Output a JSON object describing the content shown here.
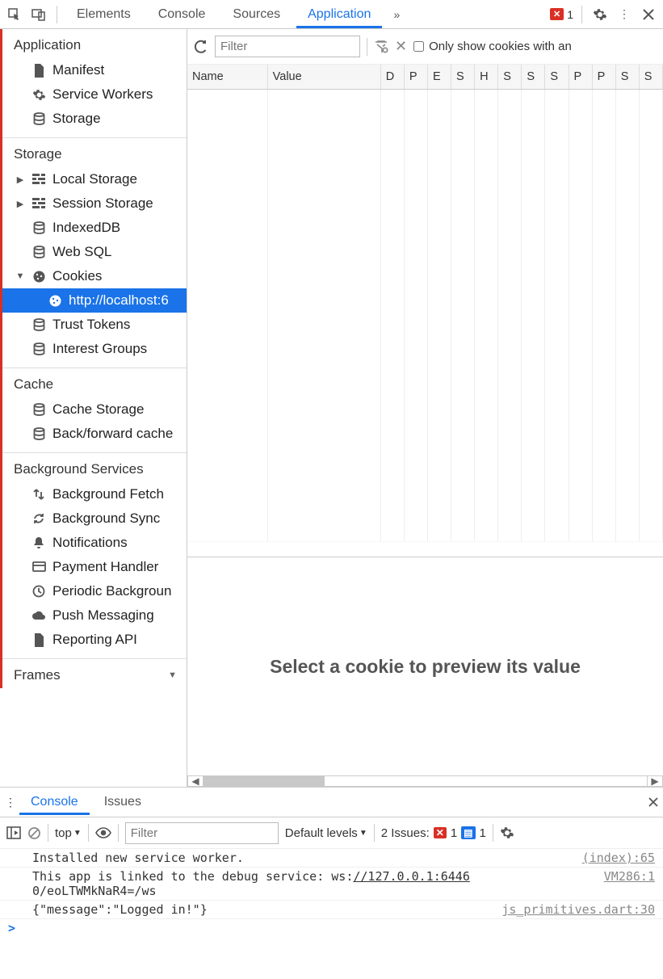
{
  "tabs": {
    "elements": "Elements",
    "console": "Console",
    "sources": "Sources",
    "application": "Application"
  },
  "error_count": "1",
  "sidebar": {
    "application": {
      "title": "Application",
      "manifest": "Manifest",
      "service_workers": "Service Workers",
      "storage": "Storage"
    },
    "storage": {
      "title": "Storage",
      "local": "Local Storage",
      "session": "Session Storage",
      "indexeddb": "IndexedDB",
      "websql": "Web SQL",
      "cookies": "Cookies",
      "cookie_origin": "http://localhost:6",
      "trust": "Trust Tokens",
      "interest": "Interest Groups"
    },
    "cache": {
      "title": "Cache",
      "cache_storage": "Cache Storage",
      "bf": "Back/forward cache"
    },
    "bg": {
      "title": "Background Services",
      "fetch": "Background Fetch",
      "sync": "Background Sync",
      "notif": "Notifications",
      "payment": "Payment Handler",
      "periodic": "Periodic Backgroun",
      "push": "Push Messaging",
      "reporting": "Reporting API"
    },
    "frames": {
      "title": "Frames"
    }
  },
  "cookie_toolbar": {
    "filter_placeholder": "Filter",
    "only_show": "Only show cookies with an"
  },
  "cookie_columns": [
    "Name",
    "Value",
    "D",
    "P",
    "E",
    "S",
    "H",
    "S",
    "S",
    "S",
    "P",
    "P",
    "S",
    "S"
  ],
  "preview_text": "Select a cookie to preview its value",
  "drawer": {
    "tabs": {
      "console": "Console",
      "issues": "Issues"
    },
    "toolbar": {
      "context": "top",
      "filter_placeholder": "Filter",
      "levels": "Default levels",
      "issues_label": "2 Issues:",
      "issue_err": "1",
      "issue_info": "1"
    },
    "lines": [
      {
        "msg": "Installed new service worker.",
        "src": "(index):65"
      },
      {
        "msg_pre": "This app is linked to the debug service: ws:",
        "msg_link": "//127.0.0.1:6446",
        "msg_post": "0/eoLTWMkNaR4=/ws",
        "src": "VM286:1"
      },
      {
        "msg": "{\"message\":\"Logged in!\"}",
        "src": "js_primitives.dart:30"
      }
    ]
  }
}
